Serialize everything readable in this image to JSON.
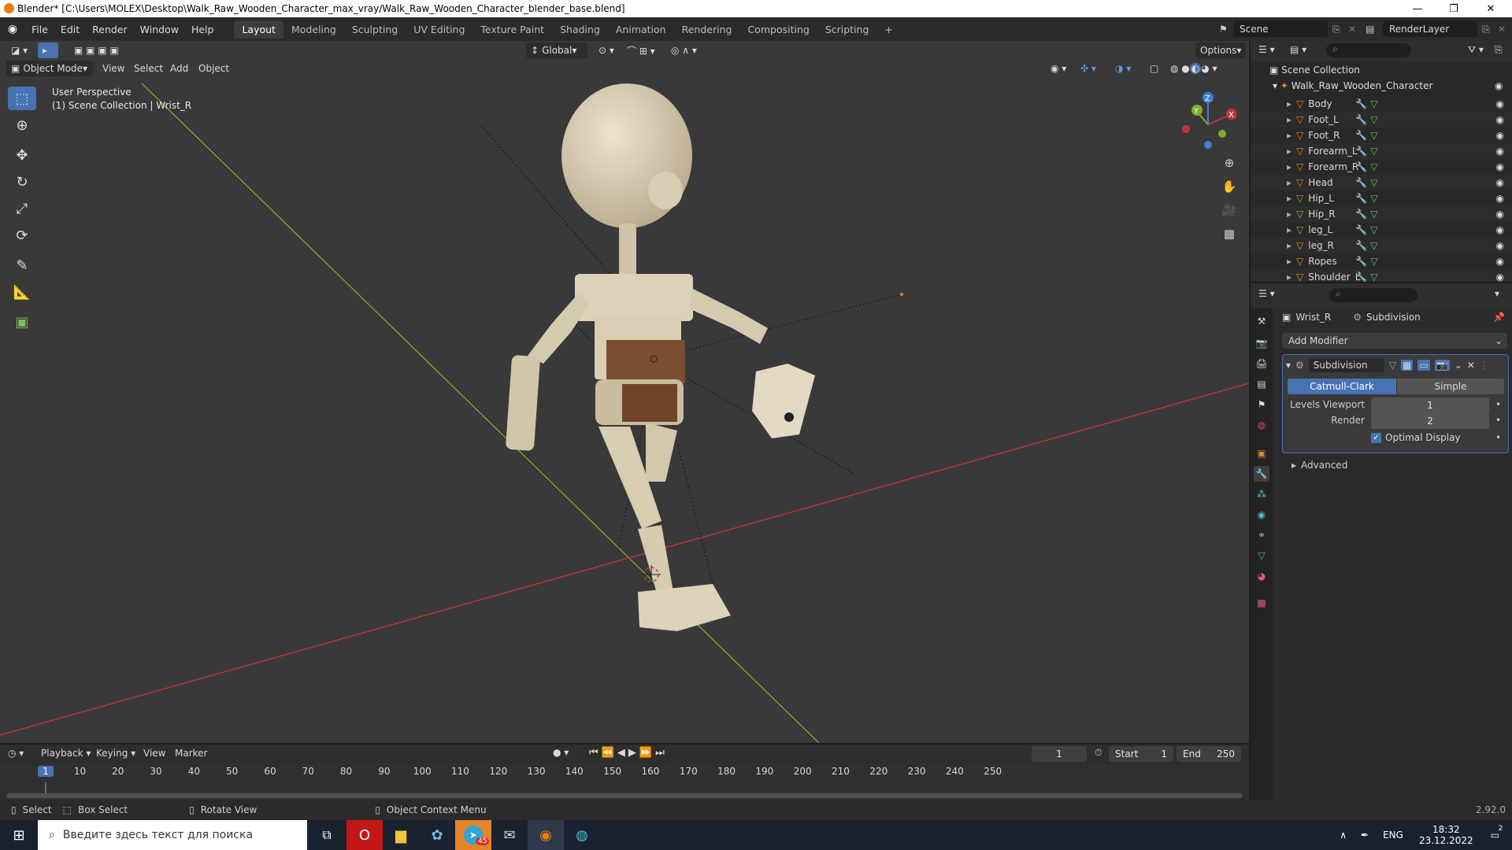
{
  "window": {
    "title": "Blender* [C:\\Users\\MOLEX\\Desktop\\Walk_Raw_Wooden_Character_max_vray/Walk_Raw_Wooden_Character_blender_base.blend]",
    "minimize": "—",
    "maximize": "❐",
    "close": "✕"
  },
  "menu": [
    "File",
    "Edit",
    "Render",
    "Window",
    "Help"
  ],
  "workspaces": [
    {
      "label": "Layout",
      "active": true
    },
    {
      "label": "Modeling"
    },
    {
      "label": "Sculpting"
    },
    {
      "label": "UV Editing"
    },
    {
      "label": "Texture Paint"
    },
    {
      "label": "Shading"
    },
    {
      "label": "Animation"
    },
    {
      "label": "Rendering"
    },
    {
      "label": "Compositing"
    },
    {
      "label": "Scripting"
    }
  ],
  "add_workspace": "+",
  "scene": {
    "label": "Scene",
    "render_layer": "RenderLayer"
  },
  "viewport": {
    "transform_orientation": "Global",
    "options": "Options",
    "mode": "Object Mode",
    "header_menu": [
      "View",
      "Select",
      "Add",
      "Object"
    ],
    "perspective_label": "User Perspective",
    "collection_label": "(1) Scene Collection | Wrist_R",
    "gizmo": {
      "z": "Z",
      "x": "X",
      "y": "Y"
    }
  },
  "outliner": {
    "root": "Scene Collection",
    "collection": "Walk_Raw_Wooden_Character",
    "items": [
      "Body",
      "Foot_L",
      "Foot_R",
      "Forearm_L",
      "Forearm_R",
      "Head",
      "Hip_L",
      "Hip_R",
      "leg_L",
      "leg_R",
      "Ropes",
      "Shoulder_L"
    ]
  },
  "properties": {
    "object": "Wrist_R",
    "modifier_context": "Subdivision",
    "add_modifier": "Add Modifier",
    "modifier": {
      "name": "Subdivision",
      "types": [
        {
          "label": "Catmull-Clark",
          "active": true
        },
        {
          "label": "Simple"
        }
      ],
      "levels_viewport_label": "Levels Viewport",
      "levels_viewport": "1",
      "render_label": "Render",
      "render": "2",
      "optimal_display_label": "Optimal Display",
      "optimal_display": true,
      "advanced": "Advanced"
    }
  },
  "timeline": {
    "menu": [
      "Playback",
      "Keying",
      "View",
      "Marker"
    ],
    "current_frame": "1",
    "start_label": "Start",
    "start": "1",
    "end_label": "End",
    "end": "250",
    "ticks": [
      "1",
      "10",
      "20",
      "30",
      "40",
      "50",
      "60",
      "70",
      "80",
      "90",
      "100",
      "110",
      "120",
      "130",
      "140",
      "150",
      "160",
      "170",
      "180",
      "190",
      "200",
      "210",
      "220",
      "230",
      "240",
      "250"
    ]
  },
  "status": {
    "select": "Select",
    "box_select": "Box Select",
    "rotate_view": "Rotate View",
    "context_menu": "Object Context Menu",
    "version": "2.92.0"
  },
  "taskbar": {
    "search_placeholder": "Введите здесь текст для поиска",
    "lang": "ENG",
    "time": "18:32",
    "date": "23.12.2022",
    "badge": "45",
    "notification_count": "2"
  },
  "colors": {
    "accent": "#4772b3",
    "x_axis": "#c4353b",
    "y_axis": "#7fad2b",
    "z_axis": "#3b82d6",
    "mesh_icon": "#e0882a",
    "modifier_icon": "#58b9d7",
    "data_icon": "#4ec27b"
  }
}
